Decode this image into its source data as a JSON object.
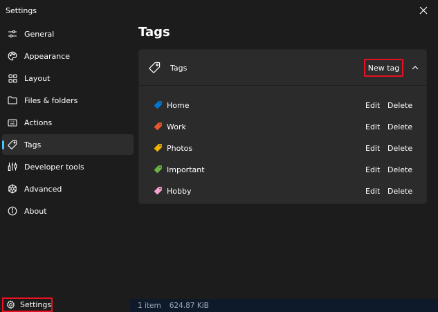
{
  "window": {
    "title": "Settings"
  },
  "sidebar": {
    "items": [
      {
        "label": "General",
        "icon": "sliders-icon"
      },
      {
        "label": "Appearance",
        "icon": "palette-icon"
      },
      {
        "label": "Layout",
        "icon": "grid-icon"
      },
      {
        "label": "Files & folders",
        "icon": "folder-icon"
      },
      {
        "label": "Actions",
        "icon": "keyboard-icon"
      },
      {
        "label": "Tags",
        "icon": "tag-icon",
        "selected": true
      },
      {
        "label": "Developer tools",
        "icon": "developer-tools-icon"
      },
      {
        "label": "Advanced",
        "icon": "advanced-icon"
      },
      {
        "label": "About",
        "icon": "info-icon"
      }
    ],
    "footer_label": "Settings"
  },
  "main": {
    "heading": "Tags",
    "card": {
      "title": "Tags",
      "new_tag_label": "New tag",
      "tags": [
        {
          "name": "Home",
          "color": "#0078d4",
          "edit": "Edit",
          "delete": "Delete"
        },
        {
          "name": "Work",
          "color": "#e8572c",
          "edit": "Edit",
          "delete": "Delete"
        },
        {
          "name": "Photos",
          "color": "#f4b400",
          "edit": "Edit",
          "delete": "Delete"
        },
        {
          "name": "Important",
          "color": "#6ab344",
          "edit": "Edit",
          "delete": "Delete"
        },
        {
          "name": "Hobby",
          "color": "#f7a1cf",
          "edit": "Edit",
          "delete": "Delete"
        }
      ]
    }
  },
  "statusbar": {
    "item_count": "1 item",
    "size": "624.87 KiB"
  },
  "colors": {
    "accent": "#4cc2ff",
    "highlight_border": "#e81123"
  }
}
